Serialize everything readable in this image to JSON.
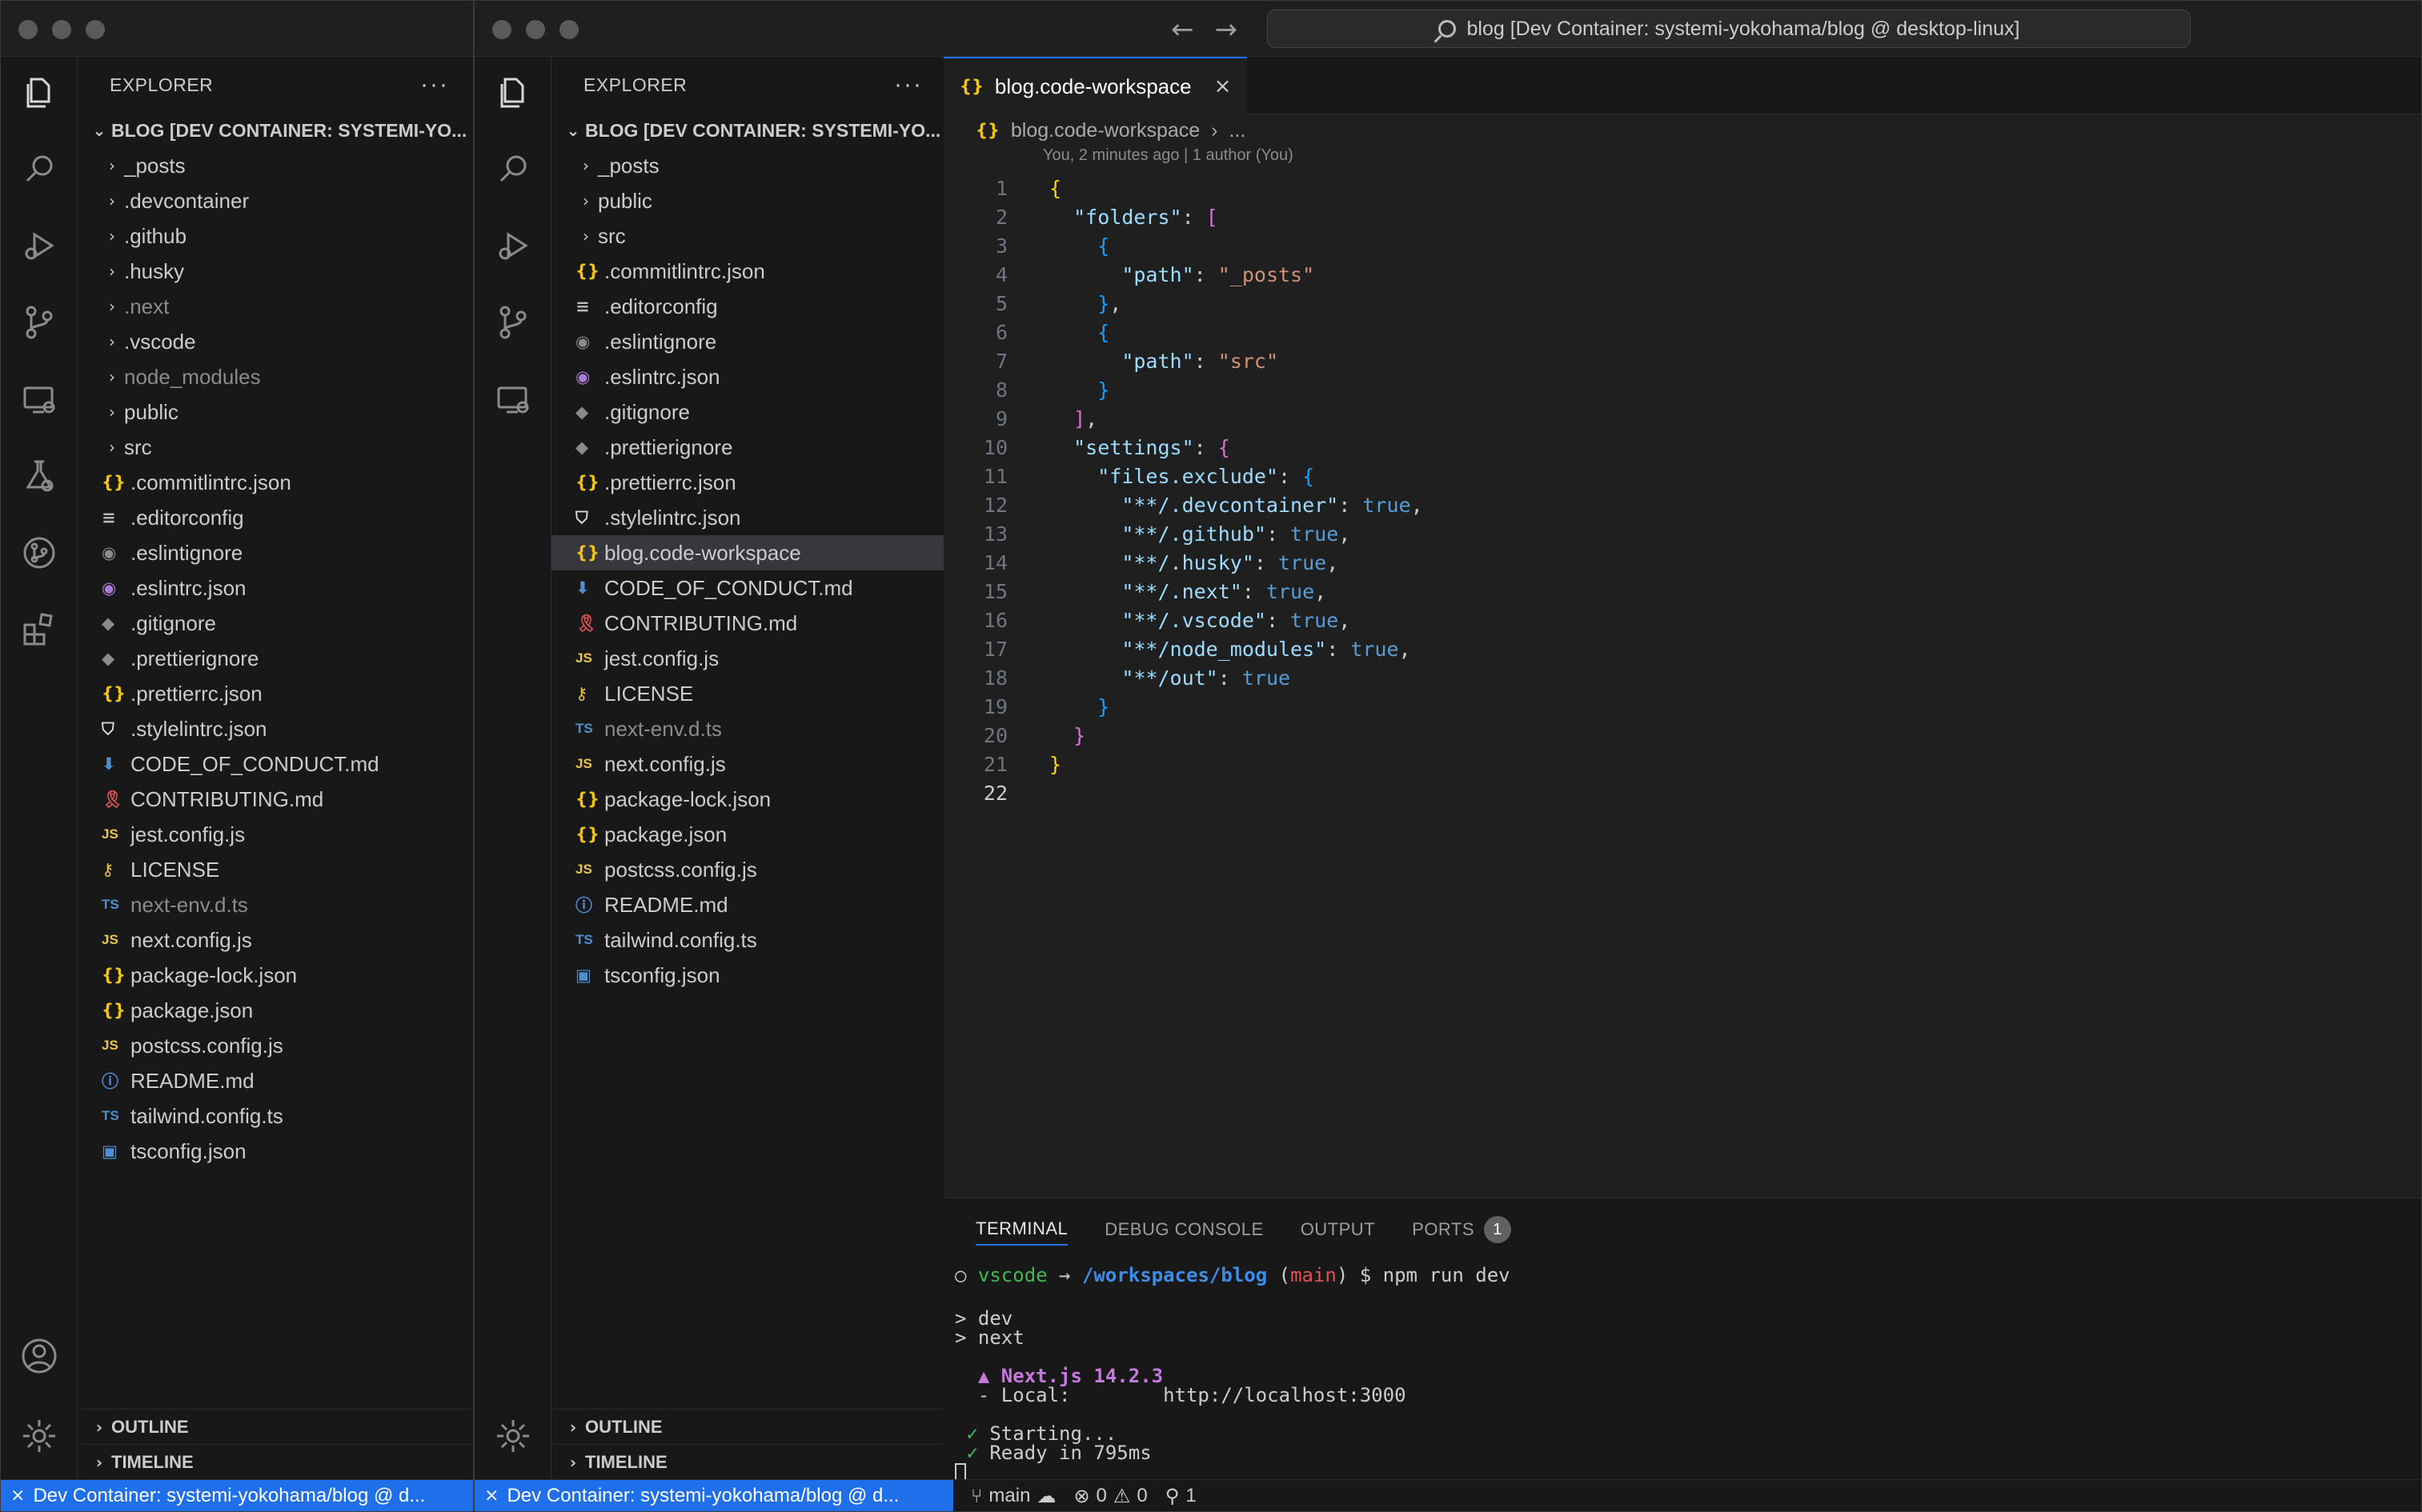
{
  "window_title": "blog [Dev Container: systemi-yokohama/blog @ desktop-linux]",
  "explorer": {
    "title": "EXPLORER",
    "more": "···",
    "project_full": "BLOG [DEV CONTAINER: SYSTEMI-YO...",
    "project_short": "BLOG [DEV CONTAINER: SYSTEMI-YO...",
    "outline": "OUTLINE",
    "timeline": "TIMELINE"
  },
  "tree_left": [
    {
      "name": "_posts",
      "kind": "folder"
    },
    {
      "name": ".devcontainer",
      "kind": "folder"
    },
    {
      "name": ".github",
      "kind": "folder"
    },
    {
      "name": ".husky",
      "kind": "folder"
    },
    {
      "name": ".next",
      "kind": "folder",
      "dim": true
    },
    {
      "name": ".vscode",
      "kind": "folder"
    },
    {
      "name": "node_modules",
      "kind": "folder",
      "dim": true
    },
    {
      "name": "public",
      "kind": "folder"
    },
    {
      "name": "src",
      "kind": "folder"
    },
    {
      "name": ".commitlintrc.json",
      "icon": "json"
    },
    {
      "name": ".editorconfig",
      "icon": "lines"
    },
    {
      "name": ".eslintignore",
      "icon": "circle"
    },
    {
      "name": ".eslintrc.json",
      "icon": "eslint"
    },
    {
      "name": ".gitignore",
      "icon": "git"
    },
    {
      "name": ".prettierignore",
      "icon": "diamond"
    },
    {
      "name": ".prettierrc.json",
      "icon": "json"
    },
    {
      "name": ".stylelintrc.json",
      "icon": "shield"
    },
    {
      "name": "CODE_OF_CONDUCT.md",
      "icon": "arrow"
    },
    {
      "name": "CONTRIBUTING.md",
      "icon": "ribbon"
    },
    {
      "name": "jest.config.js",
      "icon": "js"
    },
    {
      "name": "LICENSE",
      "icon": "key"
    },
    {
      "name": "next-env.d.ts",
      "icon": "ts",
      "dim": true
    },
    {
      "name": "next.config.js",
      "icon": "js"
    },
    {
      "name": "package-lock.json",
      "icon": "json"
    },
    {
      "name": "package.json",
      "icon": "json"
    },
    {
      "name": "postcss.config.js",
      "icon": "js"
    },
    {
      "name": "README.md",
      "icon": "info"
    },
    {
      "name": "tailwind.config.ts",
      "icon": "ts"
    },
    {
      "name": "tsconfig.json",
      "icon": "tsconf"
    }
  ],
  "tree_right": [
    {
      "name": "_posts",
      "kind": "folder"
    },
    {
      "name": "public",
      "kind": "folder"
    },
    {
      "name": "src",
      "kind": "folder"
    },
    {
      "name": ".commitlintrc.json",
      "icon": "json"
    },
    {
      "name": ".editorconfig",
      "icon": "lines"
    },
    {
      "name": ".eslintignore",
      "icon": "circle"
    },
    {
      "name": ".eslintrc.json",
      "icon": "eslint"
    },
    {
      "name": ".gitignore",
      "icon": "git"
    },
    {
      "name": ".prettierignore",
      "icon": "diamond"
    },
    {
      "name": ".prettierrc.json",
      "icon": "json"
    },
    {
      "name": ".stylelintrc.json",
      "icon": "shield"
    },
    {
      "name": "blog.code-workspace",
      "icon": "json",
      "selected": true
    },
    {
      "name": "CODE_OF_CONDUCT.md",
      "icon": "arrow"
    },
    {
      "name": "CONTRIBUTING.md",
      "icon": "ribbon"
    },
    {
      "name": "jest.config.js",
      "icon": "js"
    },
    {
      "name": "LICENSE",
      "icon": "key"
    },
    {
      "name": "next-env.d.ts",
      "icon": "ts",
      "dim": true
    },
    {
      "name": "next.config.js",
      "icon": "js"
    },
    {
      "name": "package-lock.json",
      "icon": "json"
    },
    {
      "name": "package.json",
      "icon": "json"
    },
    {
      "name": "postcss.config.js",
      "icon": "js"
    },
    {
      "name": "README.md",
      "icon": "info"
    },
    {
      "name": "tailwind.config.ts",
      "icon": "ts"
    },
    {
      "name": "tsconfig.json",
      "icon": "tsconf"
    }
  ],
  "icon_glyphs": {
    "json": "{}",
    "js": "JS",
    "ts": "TS",
    "lines": "≡",
    "circle": "◉",
    "eslint": "◉",
    "git": "◆",
    "diamond": "◆",
    "shield": "⛉",
    "arrow": "⬇",
    "ribbon": "🎗",
    "key": "⚷",
    "info": "ⓘ",
    "tsconf": "▣"
  },
  "editor": {
    "tab_label": "blog.code-workspace",
    "tab_icon": "{}",
    "close": "×",
    "breadcrumb_file": "blog.code-workspace",
    "breadcrumb_sep": "›",
    "breadcrumb_more": "...",
    "blame": "You, 2 minutes ago | 1 author (You)"
  },
  "code_lines": [
    [
      [
        "{",
        "br1"
      ]
    ],
    [
      [
        "  ",
        "ws"
      ],
      [
        "\"folders\"",
        "k"
      ],
      [
        ": ",
        "p"
      ],
      [
        "[",
        "br2"
      ]
    ],
    [
      [
        "    ",
        "ws"
      ],
      [
        "{",
        "br3"
      ]
    ],
    [
      [
        "      ",
        "ws"
      ],
      [
        "\"path\"",
        "k"
      ],
      [
        ": ",
        "p"
      ],
      [
        "\"_posts\"",
        "s"
      ]
    ],
    [
      [
        "    ",
        "ws"
      ],
      [
        "}",
        "br3"
      ],
      [
        ",",
        "p"
      ]
    ],
    [
      [
        "    ",
        "ws"
      ],
      [
        "{",
        "br3"
      ]
    ],
    [
      [
        "      ",
        "ws"
      ],
      [
        "\"path\"",
        "k"
      ],
      [
        ": ",
        "p"
      ],
      [
        "\"src\"",
        "s"
      ]
    ],
    [
      [
        "    ",
        "ws"
      ],
      [
        "}",
        "br3"
      ]
    ],
    [
      [
        "  ",
        "ws"
      ],
      [
        "]",
        "br2"
      ],
      [
        ",",
        "p"
      ]
    ],
    [
      [
        "  ",
        "ws"
      ],
      [
        "\"settings\"",
        "k"
      ],
      [
        ": ",
        "p"
      ],
      [
        "{",
        "br2"
      ]
    ],
    [
      [
        "    ",
        "ws"
      ],
      [
        "\"files.exclude\"",
        "k"
      ],
      [
        ": ",
        "p"
      ],
      [
        "{",
        "br3"
      ]
    ],
    [
      [
        "      ",
        "ws"
      ],
      [
        "\"**/.devcontainer\"",
        "k"
      ],
      [
        ": ",
        "p"
      ],
      [
        "true",
        "b"
      ],
      [
        ",",
        "p"
      ]
    ],
    [
      [
        "      ",
        "ws"
      ],
      [
        "\"**/.github\"",
        "k"
      ],
      [
        ": ",
        "p"
      ],
      [
        "true",
        "b"
      ],
      [
        ",",
        "p"
      ]
    ],
    [
      [
        "      ",
        "ws"
      ],
      [
        "\"**/.husky\"",
        "k"
      ],
      [
        ": ",
        "p"
      ],
      [
        "true",
        "b"
      ],
      [
        ",",
        "p"
      ]
    ],
    [
      [
        "      ",
        "ws"
      ],
      [
        "\"**/.next\"",
        "k"
      ],
      [
        ": ",
        "p"
      ],
      [
        "true",
        "b"
      ],
      [
        ",",
        "p"
      ]
    ],
    [
      [
        "      ",
        "ws"
      ],
      [
        "\"**/.vscode\"",
        "k"
      ],
      [
        ": ",
        "p"
      ],
      [
        "true",
        "b"
      ],
      [
        ",",
        "p"
      ]
    ],
    [
      [
        "      ",
        "ws"
      ],
      [
        "\"**/node_modules\"",
        "k"
      ],
      [
        ": ",
        "p"
      ],
      [
        "true",
        "b"
      ],
      [
        ",",
        "p"
      ]
    ],
    [
      [
        "      ",
        "ws"
      ],
      [
        "\"**/out\"",
        "k"
      ],
      [
        ": ",
        "p"
      ],
      [
        "true",
        "b"
      ]
    ],
    [
      [
        "    ",
        "ws"
      ],
      [
        "}",
        "br3"
      ]
    ],
    [
      [
        "  ",
        "ws"
      ],
      [
        "}",
        "br2"
      ]
    ],
    [
      [
        "}",
        "br1"
      ]
    ],
    []
  ],
  "panel": {
    "tabs": [
      "TERMINAL",
      "DEBUG CONSOLE",
      "OUTPUT",
      "PORTS"
    ],
    "ports_count": "1"
  },
  "terminal_lines": [
    [
      [
        "○ ",
        "p"
      ],
      [
        "vscode",
        "tg"
      ],
      [
        " → ",
        "p"
      ],
      [
        "/workspaces/blog",
        "tb"
      ],
      [
        " (",
        "p"
      ],
      [
        "main",
        "tr"
      ],
      [
        ") $ npm run dev",
        "p"
      ]
    ],
    [],
    [
      [
        "> dev",
        "p"
      ]
    ],
    [
      [
        "> next",
        "p"
      ]
    ],
    [],
    [
      [
        "  ▲ Next.js 14.2.3",
        "tm"
      ]
    ],
    [
      [
        "  - Local:        http://localhost:3000",
        "p"
      ]
    ],
    [],
    [
      [
        " ✓ ",
        "tg"
      ],
      [
        "Starting...",
        "p"
      ]
    ],
    [
      [
        " ✓ ",
        "tg"
      ],
      [
        "Ready in 795ms",
        "p"
      ]
    ]
  ],
  "status": {
    "remote_left": "Dev Container: systemi-yokohama/blog @ d...",
    "remote_right": "Dev Container: systemi-yokohama/blog @ d...",
    "branch": "main",
    "errors": "0",
    "warnings": "0",
    "ports": "1"
  }
}
